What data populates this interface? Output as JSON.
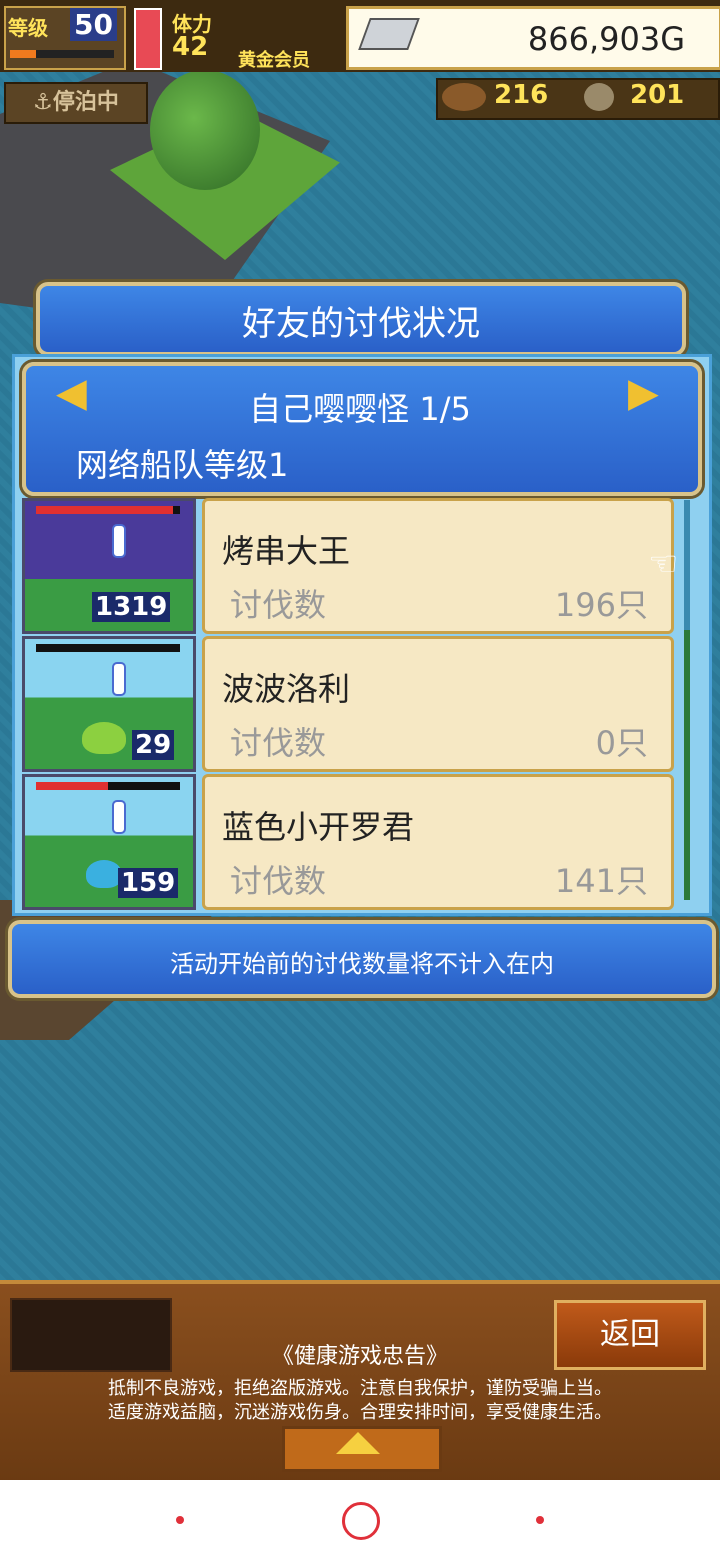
{
  "hud": {
    "level_label": "等级",
    "level": "50",
    "level_progress": 0.25,
    "stamina_label": "体力",
    "stamina": "42",
    "member": "黄金会员",
    "gold": "866,903G",
    "status": "停泊中",
    "wood": "216",
    "coins": "201"
  },
  "dialog": {
    "title": "好友的讨伐状况",
    "monster": "自己嘤嘤怪 1/5",
    "fleet_level": "网络船队等级1",
    "rows": [
      {
        "name": "烤串大王",
        "label": "讨伐数",
        "count": "196只",
        "badge": "1319",
        "hp": 0.95
      },
      {
        "name": "波波洛利",
        "label": "讨伐数",
        "count": "0只",
        "badge": "29",
        "hp": 0.0
      },
      {
        "name": "蓝色小开罗君",
        "label": "讨伐数",
        "count": "141只",
        "badge": "159",
        "hp": 0.5
      }
    ],
    "note": "活动开始前的讨伐数量将不计入在内"
  },
  "bottom": {
    "back": "返回",
    "health_title": "《健康游戏忠告》",
    "health_line1": "抵制不良游戏，拒绝盗版游戏。注意自我保护，谨防受骗上当。",
    "health_line2": "适度游戏益脑，沉迷游戏伤身。合理安排时间，享受健康生活。"
  },
  "colors": {
    "accent": "#2a60c8",
    "card": "#f6e8c4",
    "nav": "#e0303a"
  }
}
